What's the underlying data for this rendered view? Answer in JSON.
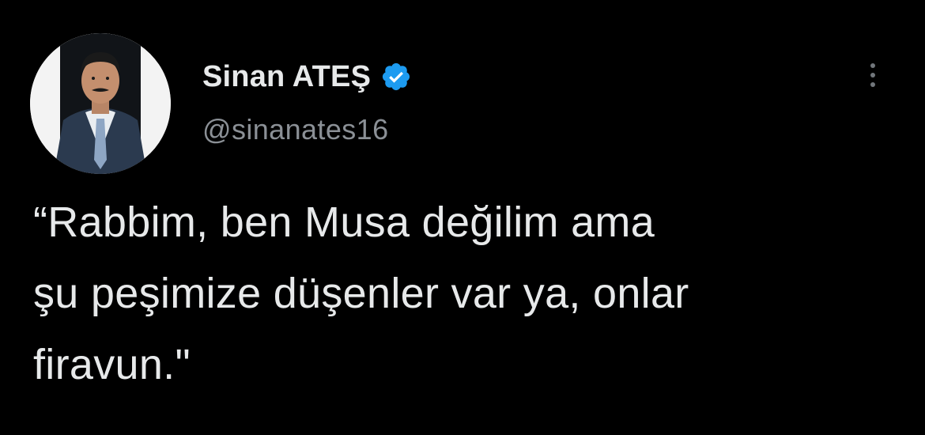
{
  "author": {
    "display_name": "Sinan ATEŞ",
    "handle": "@sinanates16",
    "verified": true,
    "avatar_icon": "profile-photo",
    "verified_icon": "verified-badge-icon"
  },
  "tweet": {
    "lines": [
      "“Rabbim, ben Musa değilim ama",
      "şu peşimize düşenler var ya, onlar",
      "firavun.\""
    ]
  },
  "menu": {
    "icon": "more-options-icon"
  },
  "colors": {
    "background": "#000000",
    "text": "#e7e9ea",
    "secondary_text": "#8b9096",
    "verified_blue": "#1d9bf0"
  }
}
